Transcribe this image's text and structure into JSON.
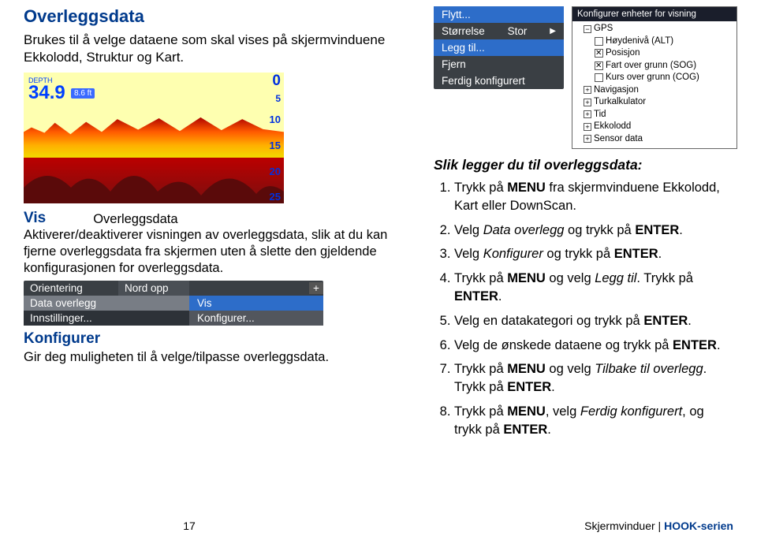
{
  "header": {
    "title": "Overleggsdata",
    "intro": "Brukes til å velge dataene som skal vises på skjermvinduene Ekkolodd, Struktur og Kart."
  },
  "sonar": {
    "depth_label": "DEPTH",
    "depth_value": "34.9",
    "badge": "8.6 ft",
    "scale": {
      "s0": "0",
      "s5": "5",
      "s10": "10",
      "s15": "15",
      "s20": "20",
      "s25": "25"
    }
  },
  "vis": {
    "head": "Vis",
    "subtitle": "Overleggsdata",
    "body": "Aktiverer/deaktiverer visningen av overleggsdata, slik at du kan fjerne overleggsdata fra skjermen uten å slette den gjeldende konfigurasjonen for overleggsdata."
  },
  "konfig": {
    "head": "Konfigurer",
    "body": "Gir deg muligheten til å velge/tilpasse overleggsdata."
  },
  "flytt_menu": {
    "items": [
      {
        "label": "Flytt...",
        "sel": true
      },
      {
        "label": "Størrelse",
        "value": "Stor"
      },
      {
        "label": "Legg til...",
        "sel": true
      },
      {
        "label": "Fjern"
      },
      {
        "label": "Ferdig konfigurert"
      }
    ]
  },
  "tree": {
    "title": "Konfigurer enheter for visning",
    "nodes": [
      {
        "exp": "−",
        "label": "GPS"
      },
      {
        "lvl": 2,
        "chk": false,
        "label": "Høydenivå (ALT)"
      },
      {
        "lvl": 2,
        "chk": true,
        "label": "Posisjon"
      },
      {
        "lvl": 2,
        "chk": true,
        "label": "Fart over grunn (SOG)"
      },
      {
        "lvl": 2,
        "chk": false,
        "label": "Kurs over grunn (COG)"
      },
      {
        "exp": "+",
        "label": "Navigasjon"
      },
      {
        "exp": "+",
        "label": "Turkalkulator"
      },
      {
        "exp": "+",
        "label": "Tid"
      },
      {
        "exp": "+",
        "label": "Ekkolodd"
      },
      {
        "exp": "+",
        "label": "Sensor data"
      }
    ]
  },
  "orient": {
    "r1": {
      "l": "Orientering",
      "m": "Nord opp",
      "plus": "+"
    },
    "r2": {
      "l": "Data overlegg"
    },
    "r3": {
      "l": "Innstillinger..."
    },
    "sub": {
      "a": "Vis",
      "b": "Konfigurer..."
    }
  },
  "steps": {
    "title": "Slik legger du til overleggsdata:",
    "items": [
      {
        "n": "1.",
        "pre": "Trykk på ",
        "b1": "MENU",
        "post": " fra skjermvinduene Ekkolodd, Kart eller DownScan."
      },
      {
        "n": "2.",
        "pre": "Velg ",
        "em": "Data overlegg",
        "mid": " og trykk på ",
        "b1": "ENTER",
        "post": "."
      },
      {
        "n": "3.",
        "pre": "Velg ",
        "em": "Konfigurer",
        "mid": " og trykk på ",
        "b1": "ENTER",
        "post": "."
      },
      {
        "n": "4.",
        "pre": "Trykk på ",
        "b1": "MENU",
        "mid": " og velg ",
        "em": "Legg til",
        "mid2": ". Trykk på ",
        "b2": "ENTER",
        "post": "."
      },
      {
        "n": "5.",
        "pre": "Velg en datakategori og trykk på ",
        "b1": "ENTER",
        "post": "."
      },
      {
        "n": "6.",
        "pre": "Velg de ønskede dataene og trykk på ",
        "b1": "ENTER",
        "post": "."
      },
      {
        "n": "7.",
        "pre": "Trykk på ",
        "b1": "MENU",
        "mid": " og velg ",
        "em": "Tilbake til overlegg",
        "mid2": ". Trykk på ",
        "b2": "ENTER",
        "post": "."
      },
      {
        "n": "8.",
        "pre": "Trykk på ",
        "b1": "MENU",
        "mid": ", velg ",
        "em": "Ferdig konfigurert",
        "mid2": ", og trykk på ",
        "b2": "ENTER",
        "post": "."
      }
    ]
  },
  "footer": {
    "page": "17",
    "crumb1": "Skjermvinduer",
    "crumb2": "HOOK-serien"
  }
}
